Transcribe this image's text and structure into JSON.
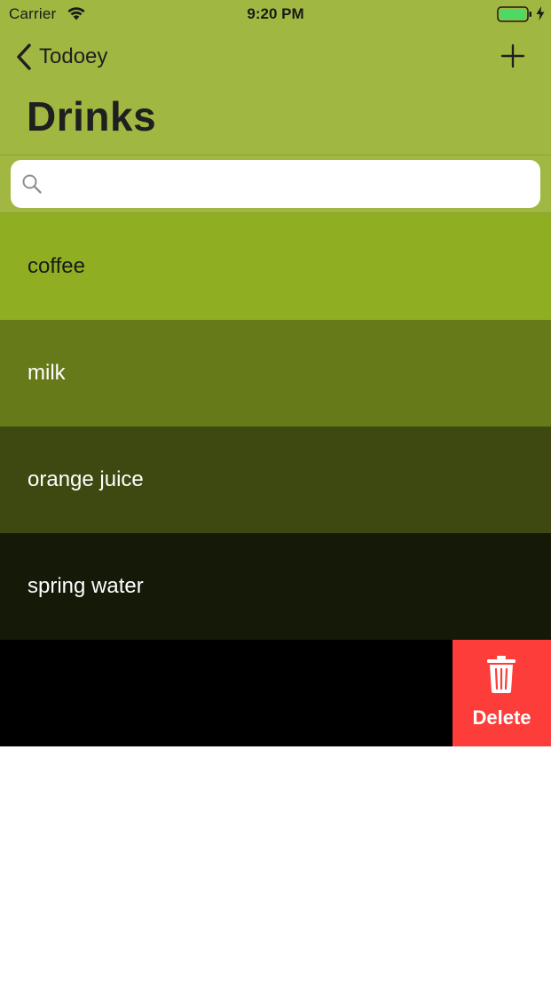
{
  "status_bar": {
    "carrier": "Carrier",
    "time": "9:20 PM",
    "icons": [
      "wifi-icon",
      "battery-icon",
      "charging-icon"
    ]
  },
  "nav": {
    "back_label": "Todoey",
    "title": "Drinks",
    "add_icon": "plus-icon"
  },
  "search": {
    "value": "",
    "placeholder": "",
    "icon": "search-icon"
  },
  "items": [
    {
      "label": "coffee",
      "bg": "#8fae22",
      "fg": "#1a1a1a"
    },
    {
      "label": "milk",
      "bg": "#677a19",
      "fg": "#ffffff"
    },
    {
      "label": "orange juice",
      "bg": "#3d4910",
      "fg": "#ffffff"
    },
    {
      "label": "spring water",
      "bg": "#141908",
      "fg": "#ffffff"
    },
    {
      "label": "",
      "bg": "#000000",
      "fg": "#ffffff"
    }
  ],
  "swipe_action": {
    "label": "Delete",
    "icon": "trash-icon",
    "color": "#fc3d39"
  },
  "colors": {
    "nav_background": "#a0b842"
  }
}
